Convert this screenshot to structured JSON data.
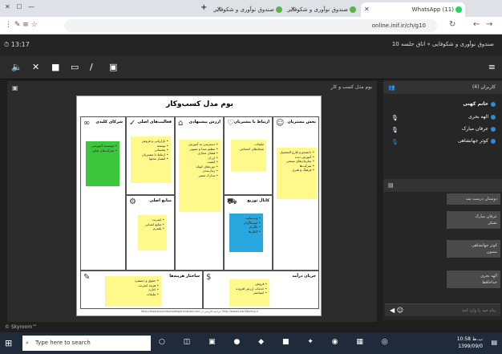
{
  "browser": {
    "tabs": [
      {
        "title": "(11) WhatsApp",
        "color": "#25d366"
      },
      {
        "title": "صندوق نوآوری و شکوفایی - اتاق...",
        "color": "#5bb34a"
      },
      {
        "title": "صندوق نوآوری و شکوفایی - اتاق...",
        "color": "#5bb34a"
      }
    ],
    "new_tab": "+",
    "url": "online.inif.ir/ch/g10"
  },
  "app": {
    "room_title": "صندوق نوآوری و شکوفایی » اتاق جلسه 10",
    "clock": "13:17",
    "panel_title": "بوم مدل کسب و کار",
    "status_text": "© Skyroom™"
  },
  "slide": {
    "title": "بوم مدل کسب‌وکار",
    "footer": "http://www.businessmodelgeneration.com   ترجمه فارسی از: http://www.LeanStartup.ir",
    "cells": {
      "segments": {
        "title": "بخش مشتریان",
        "note": "• دانشجو و فارغ التحصیل\n• آموزش دیده\n• سازمان‌های صنعتی\n• شرکت‌ها\n• فرهنگ و هنری"
      },
      "relations": {
        "title": "ارتباط با مشتریان",
        "note": "تبلیغات\nشبکه‌های اجتماعی"
      },
      "value": {
        "title": "ارزش پیشنهادی",
        "note": "• دسترسی به آموزش\n• تنظیم صدا و تصویر\n• فضای مجازی\n• ارزان\n• کیفیت\n• دوره‌های کوتاه\n• زمان‌بندی\n• مدارک معتبر"
      },
      "activities": {
        "title": "فعالیت‌های اصلی",
        "note": "• بازاریابی و فروش\n• توسعه\n• پشتیبانی\n• ارتباط با مشتریان\n• انتشار محتوا"
      },
      "partners": {
        "title": "شرکای کلیدی",
        "note": "• موسسه آموزشی\n• شرکت‌های فناور"
      },
      "resources": {
        "title": "منابع اصلی",
        "note": "• اینترنت\n• منابع انسانی\n• پلتفرم"
      },
      "channels": {
        "title": "کانال توزیع",
        "note": "• وب‌سایت\n• اینستاگرام\n• تلگرام\n• کانال‌ها"
      },
      "costs": {
        "title": "ساختار هزینه‌ها",
        "note": "• حقوق و دستمزد\n• هزینه اینترنت\n• اجاره\n• تبلیغات"
      },
      "revenue": {
        "title": "جریان درآمد",
        "note": "• فروش\n• خدمات ارزش افزوده\n• اسپانسر"
      }
    }
  },
  "participants": {
    "header": "کاربران (4)",
    "list": [
      {
        "name": "خانم کهنی",
        "bold": true,
        "mic": false
      },
      {
        "name": "الهه بحری",
        "bold": false,
        "mic": true
      },
      {
        "name": "عرفان مبارک",
        "bold": false,
        "mic": true
      },
      {
        "name": "کوثر جهانشاهی",
        "bold": false,
        "mic": true
      }
    ]
  },
  "chat": {
    "header": "",
    "messages": [
      {
        "text": "دوستان درست شد"
      },
      {
        "text": "عرفان مبارک\nتشکر"
      },
      {
        "text": "کوثر جهانشاهی\nممنون"
      },
      {
        "text": "الهه بحری\nخداحافظ"
      }
    ],
    "input_placeholder": "پیام خود را وارد کنید"
  },
  "taskbar": {
    "search_placeholder": "Type here to search",
    "time": "10:58 ب.ظ",
    "date": "1399/09/0"
  }
}
